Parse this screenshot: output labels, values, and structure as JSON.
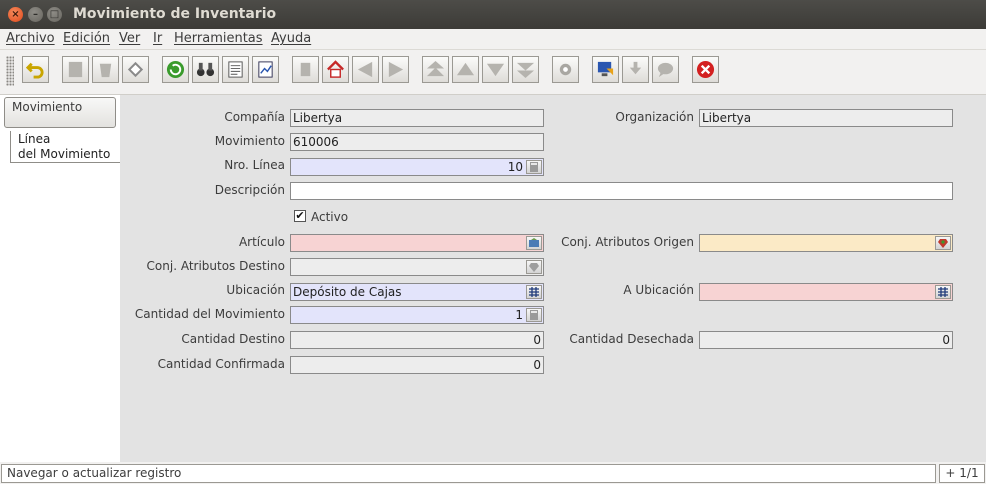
{
  "window": {
    "title": "Movimiento de Inventario"
  },
  "menu": [
    "Archivo",
    "Edición",
    "Ver",
    "Ir",
    "Herramientas",
    "Ayuda"
  ],
  "toolbar": {
    "buttons": [
      "undo",
      "new",
      "delete",
      "save",
      "refresh",
      "find",
      "history",
      "report",
      "detail",
      "attachment",
      "home",
      "previous",
      "next",
      "first",
      "up",
      "down",
      "last",
      "print",
      "archive",
      "zoom-across",
      "chat",
      "request",
      "exit"
    ]
  },
  "tabs": {
    "tab1": "Movimiento",
    "tab2": "Línea\ndel Movimiento"
  },
  "form": {
    "compania": {
      "label": "Compañía",
      "value": "Libertya"
    },
    "organizacion": {
      "label": "Organización",
      "value": "Libertya"
    },
    "movimiento": {
      "label": "Movimiento",
      "value": "610006"
    },
    "nro_linea": {
      "label": "Nro. Línea",
      "value": "10"
    },
    "descripcion": {
      "label": "Descripción",
      "value": ""
    },
    "activo": {
      "label": "Activo",
      "checked": "✔"
    },
    "articulo": {
      "label": "Artículo",
      "value": ""
    },
    "conj_atributos_origen": {
      "label": "Conj. Atributos Origen",
      "value": ""
    },
    "conj_atributos_destino": {
      "label": "Conj. Atributos Destino",
      "value": ""
    },
    "ubicacion": {
      "label": "Ubicación",
      "value": "Depósito de Cajas"
    },
    "a_ubicacion": {
      "label": "A Ubicación",
      "value": ""
    },
    "cantidad_movimiento": {
      "label": "Cantidad del Movimiento",
      "value": "1"
    },
    "cantidad_destino": {
      "label": "Cantidad Destino",
      "value": "0"
    },
    "cantidad_desechada": {
      "label": "Cantidad Desechada",
      "value": "0"
    },
    "cantidad_confirmada": {
      "label": "Cantidad Confirmada",
      "value": "0"
    }
  },
  "colors": {
    "mandatory": "#e3e4fb",
    "missing": "#f7d3d3",
    "optional_lookup": "#fbeac6",
    "readonly": "#ededed"
  },
  "status": {
    "message": "Navegar o actualizar registro",
    "record": "+ 1/1"
  }
}
